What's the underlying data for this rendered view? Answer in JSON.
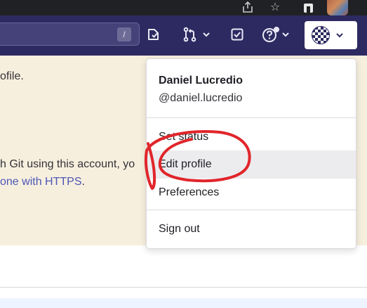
{
  "search": {
    "shortcut": "/"
  },
  "page": {
    "profile_fragment": "ofile.",
    "git_fragment": "h Git using this account, yo",
    "clone_link": "one with HTTPS",
    "clone_period": "."
  },
  "user_menu": {
    "name": "Daniel Lucredio",
    "username": "@daniel.lucredio",
    "items": [
      {
        "label": "Set status"
      },
      {
        "label": "Edit profile",
        "highlighted": true
      },
      {
        "label": "Preferences"
      },
      {
        "label": "Sign out"
      }
    ]
  },
  "colors": {
    "navbar": "#2d2a61",
    "banner": "#f7efde",
    "link": "#4a56b5",
    "annotation": "#e0262b",
    "highlight": "#ececef"
  },
  "icons": {
    "todo": "todo-icon",
    "merge_requests": "merge-request-icon",
    "issues": "issues-icon",
    "help": "help-icon",
    "avatar": "user-avatar"
  }
}
